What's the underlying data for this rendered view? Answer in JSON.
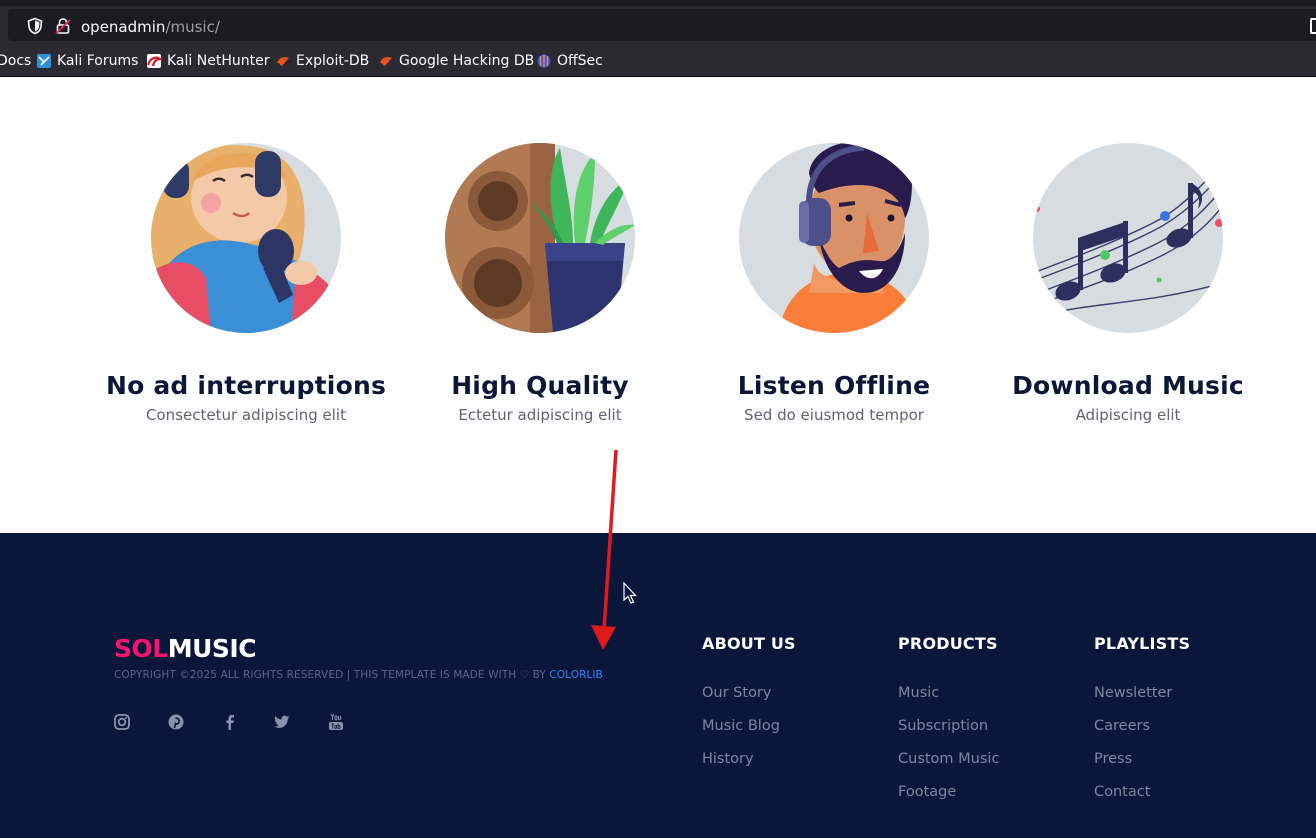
{
  "browser": {
    "url_host": "openadmin",
    "url_path": "/music/",
    "bookmarks": [
      {
        "label": "Docs",
        "icon": "none"
      },
      {
        "label": "Kali Forums",
        "icon": "kali-forums-icon"
      },
      {
        "label": "Kali NetHunter",
        "icon": "kali-nethunter-icon"
      },
      {
        "label": "Exploit-DB",
        "icon": "exploit-db-icon"
      },
      {
        "label": "Google Hacking DB",
        "icon": "google-hacking-db-icon"
      },
      {
        "label": "OffSec",
        "icon": "offsec-icon"
      }
    ]
  },
  "features": [
    {
      "title": "No ad interruptions",
      "subtitle": "Consectetur adipiscing elit",
      "image": "singer-illustration"
    },
    {
      "title": "High Quality",
      "subtitle": "Ectetur adipiscing elit",
      "image": "speaker-plant-illustration"
    },
    {
      "title": "Listen Offline",
      "subtitle": "Sed do eiusmod tempor",
      "image": "headphones-man-illustration"
    },
    {
      "title": "Download Music",
      "subtitle": "Adipiscing elit",
      "image": "music-notes-illustration"
    }
  ],
  "footer": {
    "logo_sol": "SOL",
    "logo_music": "MUSIC",
    "copyright_text": "COPYRIGHT ©2025 ALL RIGHTS RESERVED | THIS TEMPLATE IS MADE WITH ♡ BY ",
    "copyright_link": "COLORLIB",
    "socials": [
      "instagram-icon",
      "pinterest-icon",
      "facebook-icon",
      "twitter-icon",
      "youtube-icon"
    ],
    "columns": [
      {
        "heading": "ABOUT US",
        "links": [
          "Our Story",
          "Music Blog",
          "History"
        ]
      },
      {
        "heading": "PRODUCTS",
        "links": [
          "Music",
          "Subscription",
          "Custom Music",
          "Footage"
        ]
      },
      {
        "heading": "PLAYLISTS",
        "links": [
          "Newsletter",
          "Careers",
          "Press",
          "Contact"
        ]
      }
    ]
  },
  "colors": {
    "footer_bg": "#0b163b",
    "brand_pink": "#f2156d",
    "link_blue": "#2a86ff",
    "heading_navy": "#0b1737",
    "annotation_red": "#e0191c"
  }
}
